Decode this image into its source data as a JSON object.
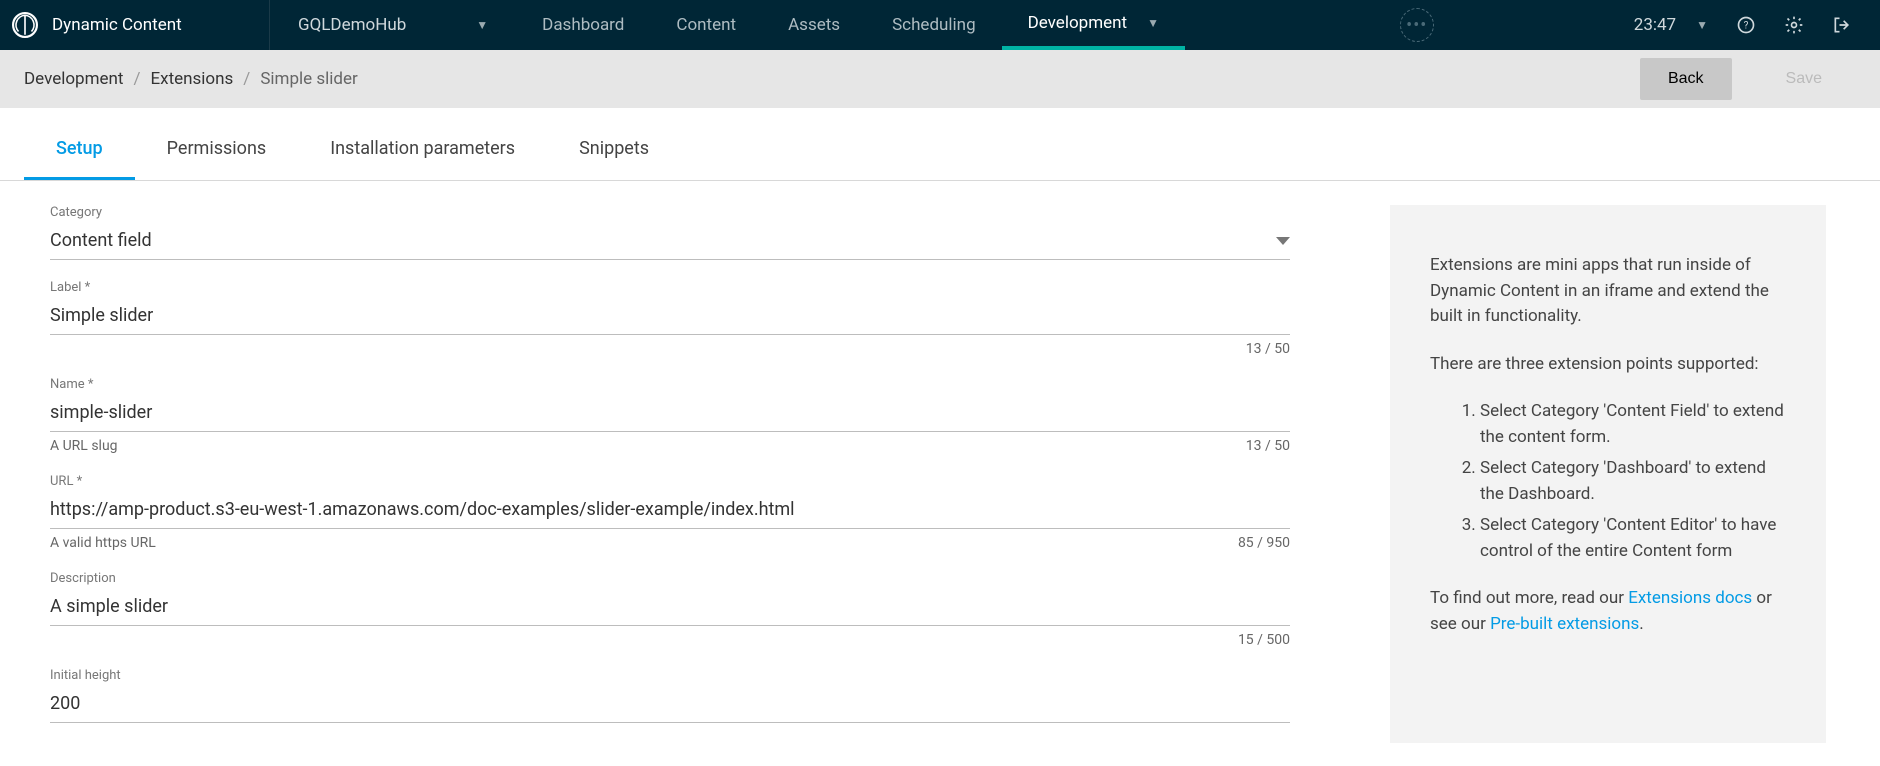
{
  "header": {
    "brand": "Dynamic Content",
    "hub": "GQLDemoHub",
    "time": "23:47",
    "nav": {
      "dashboard": "Dashboard",
      "content": "Content",
      "assets": "Assets",
      "scheduling": "Scheduling",
      "development": "Development"
    }
  },
  "subheader": {
    "crumbs": {
      "development": "Development",
      "extensions": "Extensions",
      "current": "Simple slider"
    },
    "back": "Back",
    "save": "Save"
  },
  "tabs": {
    "setup": "Setup",
    "permissions": "Permissions",
    "install_params": "Installation parameters",
    "snippets": "Snippets"
  },
  "form": {
    "category": {
      "label": "Category",
      "value": "Content field"
    },
    "label": {
      "label": "Label *",
      "value": "Simple slider",
      "counter": "13 / 50"
    },
    "name": {
      "label": "Name *",
      "value": "simple-slider",
      "helper": "A URL slug",
      "counter": "13 / 50"
    },
    "url": {
      "label": "URL *",
      "value": "https://amp-product.s3-eu-west-1.amazonaws.com/doc-examples/slider-example/index.html",
      "helper": "A valid https URL",
      "counter": "85 / 950"
    },
    "description": {
      "label": "Description",
      "value": "A simple slider",
      "counter": "15 / 500"
    },
    "height": {
      "label": "Initial height",
      "value": "200"
    }
  },
  "help": {
    "p1": "Extensions are mini apps that run inside of Dynamic Content in an iframe and extend the built in functionality.",
    "p2": "There are three extension points supported:",
    "li1": "Select Category 'Content Field' to extend the content form.",
    "li2": "Select Category 'Dashboard' to extend the Dashboard.",
    "li3": "Select Category 'Content Editor' to have control of the entire Content form",
    "p3a": "To find out more, read our ",
    "link1": "Extensions docs",
    "p3b": " or see our ",
    "link2": "Pre-built extensions",
    "p3c": "."
  }
}
